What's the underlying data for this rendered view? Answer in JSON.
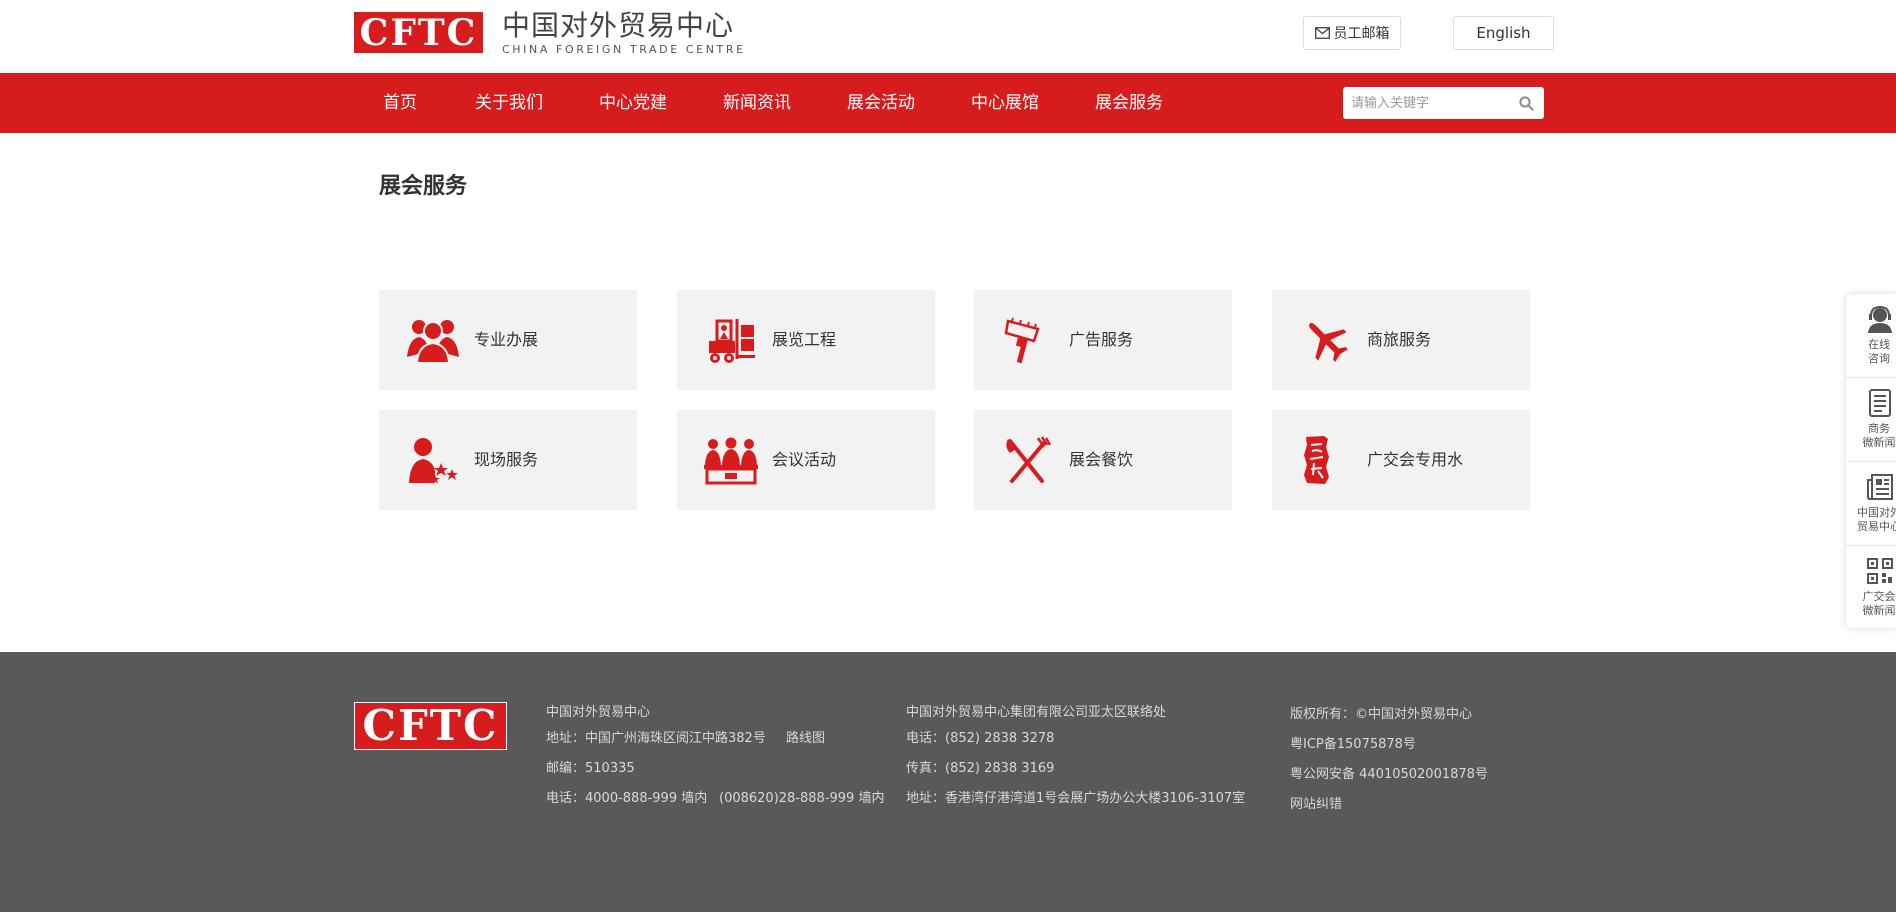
{
  "header": {
    "logo_text": "CFTC",
    "logo_cn": "中国对外贸易中心",
    "logo_en": "CHINA FOREIGN TRADE CENTRE",
    "mail_label": "员工邮箱",
    "english_label": "English"
  },
  "nav": {
    "items": [
      "首页",
      "关于我们",
      "中心党建",
      "新闻资讯",
      "展会活动",
      "中心展馆",
      "展会服务"
    ],
    "search_placeholder": "请输入关键字",
    "search_value": ""
  },
  "main": {
    "title": "展会服务",
    "cards": [
      {
        "label": "专业办展",
        "icon": "people-group-icon"
      },
      {
        "label": "展览工程",
        "icon": "forklift-icon"
      },
      {
        "label": "广告服务",
        "icon": "paint-brush-icon"
      },
      {
        "label": "商旅服务",
        "icon": "airplane-icon"
      },
      {
        "label": "现场服务",
        "icon": "person-stars-icon"
      },
      {
        "label": "会议活动",
        "icon": "meeting-icon"
      },
      {
        "label": "展会餐饮",
        "icon": "fork-knife-icon"
      },
      {
        "label": "广交会专用水",
        "icon": "water-seal-icon"
      }
    ]
  },
  "sidebar": {
    "items": [
      {
        "line1": "在线",
        "line2": "咨询",
        "icon": "customer-service-icon"
      },
      {
        "line1": "商务",
        "line2": "微新闻",
        "icon": "news-icon"
      },
      {
        "line1": "中国对外",
        "line2": "贸易中心",
        "icon": "newspaper-icon"
      },
      {
        "line1": "广交会",
        "line2": "微新闻",
        "icon": "qrcode-icon"
      }
    ]
  },
  "footer": {
    "logo_text": "CFTC",
    "col1": {
      "title": "中国对外贸易中心",
      "address": "地址：中国广州海珠区阅江中路382号",
      "route": "路线图",
      "postcode": "邮编：510335",
      "phone": "电话：4000-888-999 墙内",
      "phone2": "(008620)28-888-999 墙内"
    },
    "col2": {
      "title": "中国对外贸易中心集团有限公司亚太区联络处",
      "phone": "电话：(852) 2838 3278",
      "fax": "传真：(852) 2838 3169",
      "address": "地址：香港湾仔港湾道1号会展广场办公大楼3106-3107室"
    },
    "col3": {
      "copyright": "版权所有：©中国对外贸易中心",
      "icp": "粤ICP备15075878号",
      "police": "粤公网安备 44010502001878号",
      "report": "网站纠错"
    }
  },
  "colors": {
    "brand_red": "#d71c1e",
    "footer_bg": "#595959",
    "card_bg": "#f2f2f2"
  }
}
